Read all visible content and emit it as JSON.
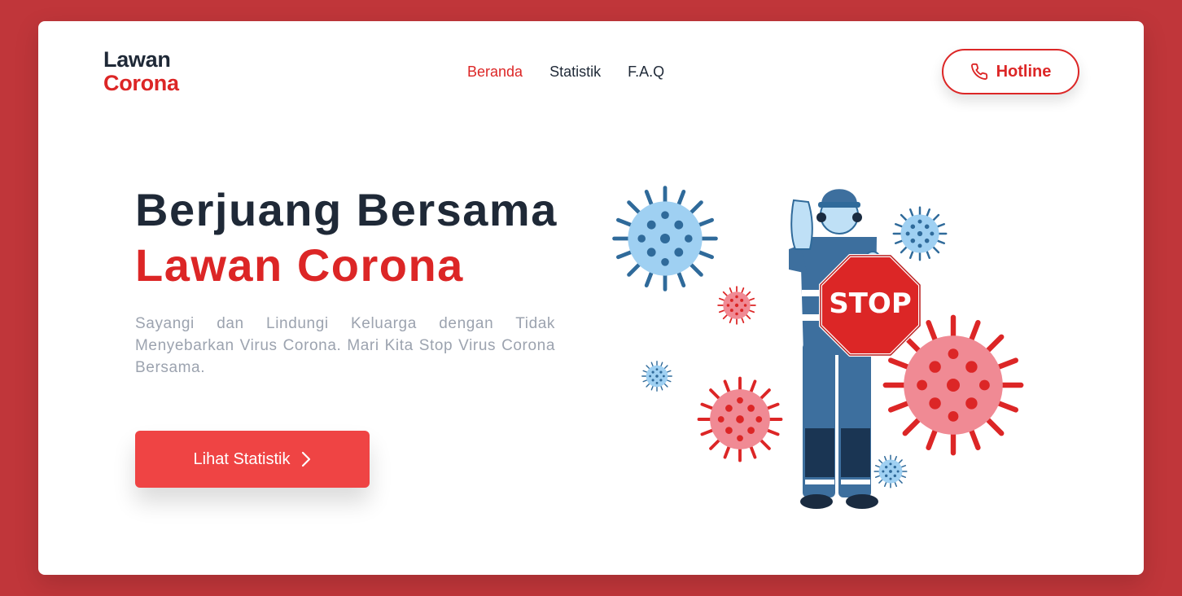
{
  "logo": {
    "line1": "Lawan",
    "line2": "Corona"
  },
  "nav": {
    "items": [
      {
        "label": "Beranda",
        "active": true
      },
      {
        "label": "Statistik",
        "active": false
      },
      {
        "label": "F.A.Q",
        "active": false
      }
    ]
  },
  "hotline": {
    "label": "Hotline",
    "icon": "phone-icon"
  },
  "hero": {
    "title_line1": "Berjuang Bersama",
    "title_line2": "Lawan Corona",
    "description": "Sayangi dan Lindungi Keluarga dengan Tidak Menyebarkan Virus Corona. Mari Kita Stop Virus Corona Bersama.",
    "cta_label": "Lihat Statistik",
    "cta_icon": "chevron-right-icon"
  },
  "illustration": {
    "sign_text": "STOP"
  },
  "colors": {
    "background": "#c0363a",
    "accent": "#dc2626",
    "button": "#ef4444",
    "text_dark": "#1f2937",
    "text_muted": "#9ca3af"
  }
}
